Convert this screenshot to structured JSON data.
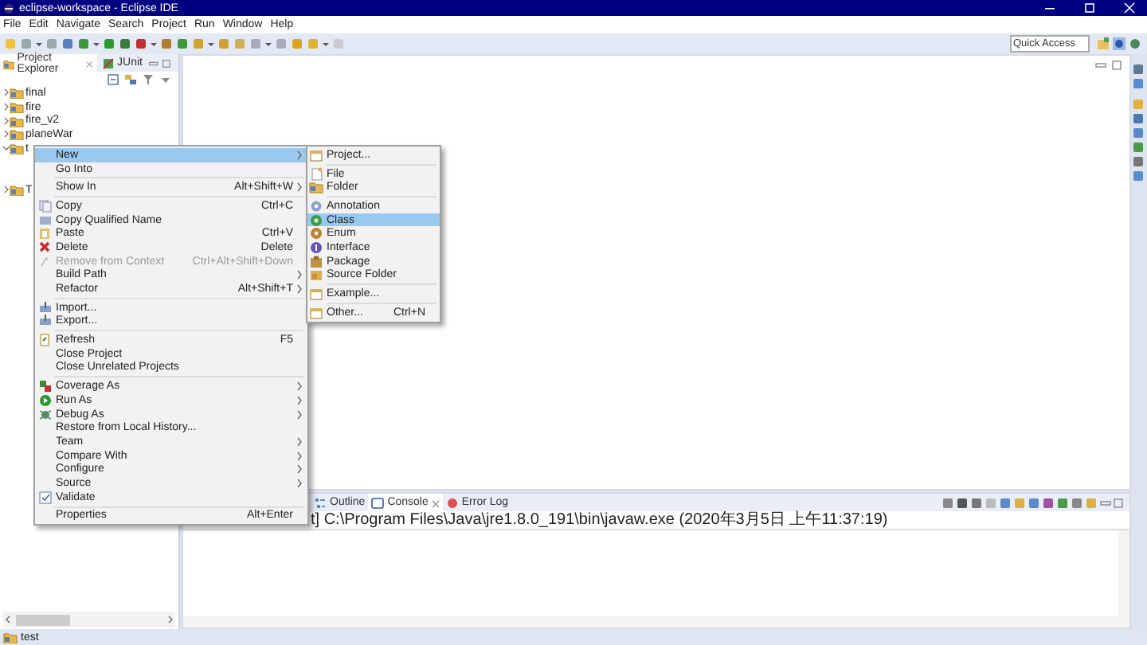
{
  "window": {
    "title": "eclipse-workspace - Eclipse IDE"
  },
  "menu_bar": [
    "File",
    "Edit",
    "Navigate",
    "Search",
    "Project",
    "Run",
    "Window",
    "Help"
  ],
  "quick_access": {
    "placeholder": "Quick Access"
  },
  "left_view": {
    "tabs": [
      {
        "label": "Project Explorer",
        "selected": true
      },
      {
        "label": "JUnit",
        "selected": false
      }
    ],
    "tree": [
      {
        "label": "final",
        "expanded": false
      },
      {
        "label": "fire",
        "expanded": false
      },
      {
        "label": "fire_v2",
        "expanded": false
      },
      {
        "label": "planeWar",
        "expanded": false
      },
      {
        "label": "t",
        "expanded": true
      },
      {
        "kind": "covered"
      },
      {
        "kind": "covered"
      },
      {
        "label": "T",
        "expanded": false
      }
    ]
  },
  "context_menu": [
    {
      "kind": "item",
      "label": "New",
      "submenu": true,
      "selected": true
    },
    {
      "kind": "item",
      "label": "Go Into"
    },
    {
      "kind": "separator"
    },
    {
      "kind": "item",
      "label": "Show In",
      "shortcut": "Alt+Shift+W",
      "submenu": true
    },
    {
      "kind": "separator"
    },
    {
      "kind": "item",
      "label": "Copy",
      "shortcut": "Ctrl+C"
    },
    {
      "kind": "item",
      "label": "Copy Qualified Name"
    },
    {
      "kind": "item",
      "label": "Paste",
      "shortcut": "Ctrl+V"
    },
    {
      "kind": "item",
      "label": "Delete",
      "shortcut": "Delete"
    },
    {
      "kind": "item",
      "label": "Remove from Context",
      "shortcut": "Ctrl+Alt+Shift+Down",
      "disabled": true
    },
    {
      "kind": "item",
      "label": "Build Path",
      "submenu": true
    },
    {
      "kind": "item",
      "label": "Refactor",
      "shortcut": "Alt+Shift+T",
      "submenu": true
    },
    {
      "kind": "separator"
    },
    {
      "kind": "item",
      "label": "Import..."
    },
    {
      "kind": "item",
      "label": "Export..."
    },
    {
      "kind": "separator"
    },
    {
      "kind": "item",
      "label": "Refresh",
      "shortcut": "F5"
    },
    {
      "kind": "item",
      "label": "Close Project"
    },
    {
      "kind": "item",
      "label": "Close Unrelated Projects"
    },
    {
      "kind": "separator"
    },
    {
      "kind": "item",
      "label": "Coverage As",
      "submenu": true
    },
    {
      "kind": "item",
      "label": "Run As",
      "submenu": true
    },
    {
      "kind": "item",
      "label": "Debug As",
      "submenu": true
    },
    {
      "kind": "item",
      "label": "Restore from Local History..."
    },
    {
      "kind": "item",
      "label": "Team",
      "submenu": true
    },
    {
      "kind": "item",
      "label": "Compare With",
      "submenu": true
    },
    {
      "kind": "item",
      "label": "Configure",
      "submenu": true
    },
    {
      "kind": "item",
      "label": "Source",
      "submenu": true
    },
    {
      "kind": "item",
      "label": "Validate"
    },
    {
      "kind": "separator"
    },
    {
      "kind": "item",
      "label": "Properties",
      "shortcut": "Alt+Enter"
    }
  ],
  "submenu": [
    {
      "kind": "item",
      "label": "Project..."
    },
    {
      "kind": "separator"
    },
    {
      "kind": "item",
      "label": "File"
    },
    {
      "kind": "item",
      "label": "Folder"
    },
    {
      "kind": "separator"
    },
    {
      "kind": "item",
      "label": "Annotation"
    },
    {
      "kind": "item",
      "label": "Class",
      "selected": true
    },
    {
      "kind": "item",
      "label": "Enum"
    },
    {
      "kind": "item",
      "label": "Interface"
    },
    {
      "kind": "item",
      "label": "Package"
    },
    {
      "kind": "item",
      "label": "Source Folder"
    },
    {
      "kind": "separator"
    },
    {
      "kind": "item",
      "label": "Example..."
    },
    {
      "kind": "separator"
    },
    {
      "kind": "item",
      "label": "Other...",
      "shortcut": "Ctrl+N"
    }
  ],
  "bottom_view": {
    "tabs": [
      {
        "label": "Outline",
        "selected": false
      },
      {
        "label": "Console",
        "selected": true
      },
      {
        "label": "Error Log",
        "selected": false
      }
    ],
    "console_line": "t] C:\\Program Files\\Java\\jre1.8.0_191\\bin\\javaw.exe (2020年3月5日 上午11:37:19)"
  },
  "status_bar": {
    "text": "test"
  }
}
